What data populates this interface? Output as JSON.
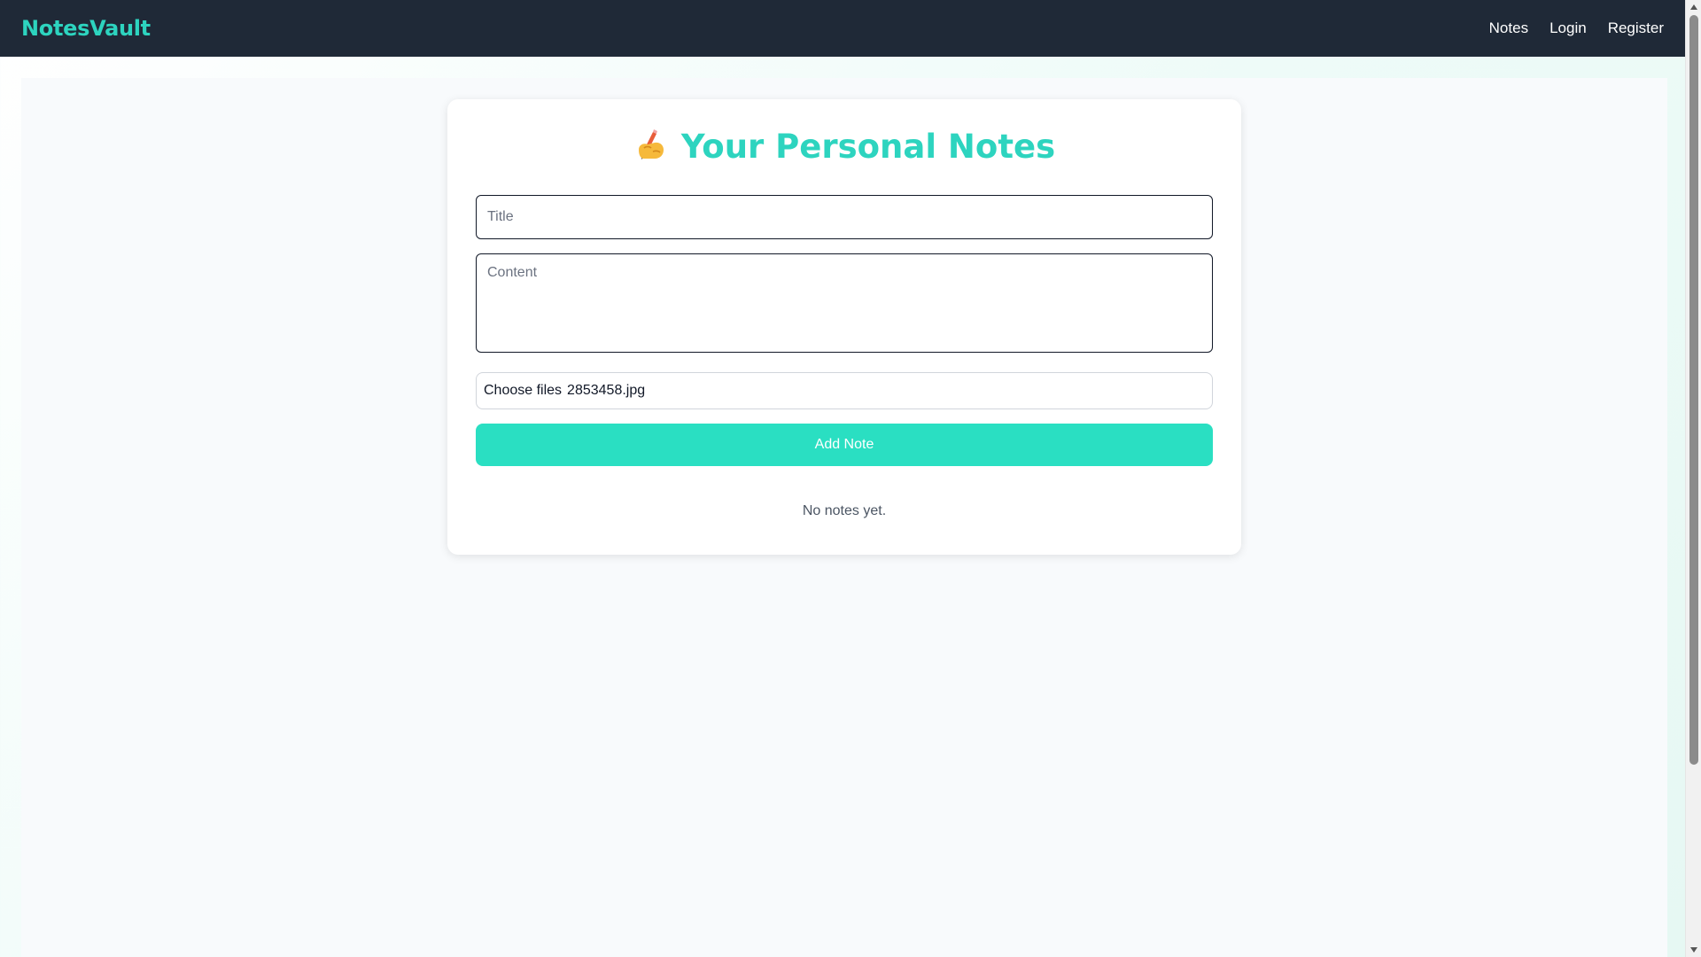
{
  "navbar": {
    "brand": "NotesVault",
    "links": [
      {
        "label": "Notes"
      },
      {
        "label": "Login"
      },
      {
        "label": "Register"
      }
    ]
  },
  "card": {
    "title_icon": "writing-hand-icon",
    "title": "Your Personal Notes",
    "title_placeholder": "Title",
    "content_placeholder": "Content",
    "file_button_label": "Choose files",
    "file_name": "2853458.jpg",
    "add_button_label": "Add Note",
    "empty_message": "No notes yet."
  },
  "colors": {
    "accent": "#2dd4bf",
    "navbar_bg": "#1f2937",
    "button_bg": "#2adfc2"
  }
}
